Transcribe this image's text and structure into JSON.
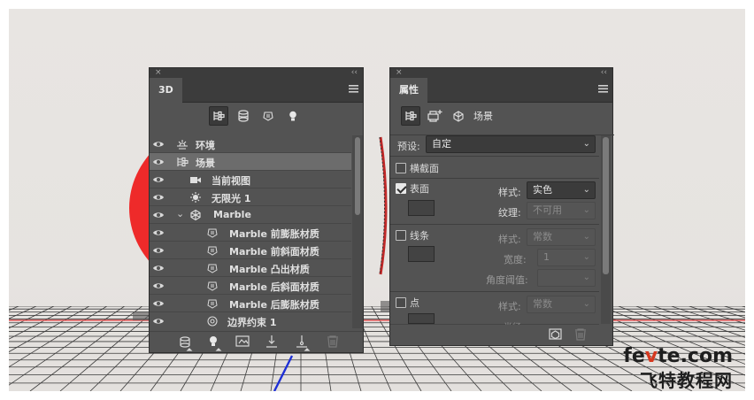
{
  "panel3d": {
    "collapse_glyph": "‹‹",
    "close_glyph": "×",
    "tab": "3D",
    "filter_buttons": [
      "whole-scene-icon",
      "mesh-icon",
      "material-icon",
      "light-icon"
    ],
    "layers": [
      {
        "label": "环境",
        "icon": "environment-icon"
      },
      {
        "label": "场景",
        "icon": "scene-icon",
        "selected": true
      },
      {
        "label": "当前视图",
        "icon": "camera-icon"
      },
      {
        "label": "无限光 1",
        "icon": "infinite-light-icon"
      },
      {
        "label": "Marble",
        "icon": "mesh-icon",
        "expanded": true
      },
      {
        "label": "Marble 前膨胀材质",
        "icon": "material-icon"
      },
      {
        "label": "Marble 前斜面材质",
        "icon": "material-icon"
      },
      {
        "label": "Marble 凸出材质",
        "icon": "material-icon"
      },
      {
        "label": "Marble 后斜面材质",
        "icon": "material-icon"
      },
      {
        "label": "Marble 后膨胀材质",
        "icon": "material-icon"
      },
      {
        "label": "边界约束 1",
        "icon": "constraint-icon"
      }
    ],
    "footer_buttons": [
      "add-mesh-icon",
      "add-light-icon",
      "scene-settings-icon",
      "move-to-ground-icon",
      "drop-to-plane-icon",
      "trash-icon"
    ]
  },
  "properties": {
    "collapse_glyph": "‹‹",
    "close_glyph": "×",
    "tab": "属性",
    "toolbar_title": "场景",
    "preset_label": "预设:",
    "preset_value": "自定",
    "cross_section": "横截面",
    "surface": {
      "label": "表面",
      "style_label": "样式:",
      "style_value": "实色",
      "texture_label": "纹理:",
      "texture_value": "不可用"
    },
    "lines": {
      "label": "线条",
      "style_label": "样式:",
      "style_value": "常数",
      "width_label": "宽度:",
      "width_value": "1",
      "angle_label": "角度阈值:"
    },
    "points": {
      "label": "点",
      "style_label": "样式:",
      "style_value": "常数",
      "radius_label": "半径:"
    }
  },
  "watermark": {
    "line1_a": "fe",
    "line1_b": "v",
    "line1_c": "te.com",
    "line2": "飞特教程网"
  },
  "colors": {
    "panel_bg": "#535353",
    "panel_dark": "#3c3c3c",
    "selected_row": "#6c6c6c",
    "sphere_red": "#ee2a2a",
    "axis_blue": "#1d2fd6",
    "ground_red_line": "#e05858"
  }
}
